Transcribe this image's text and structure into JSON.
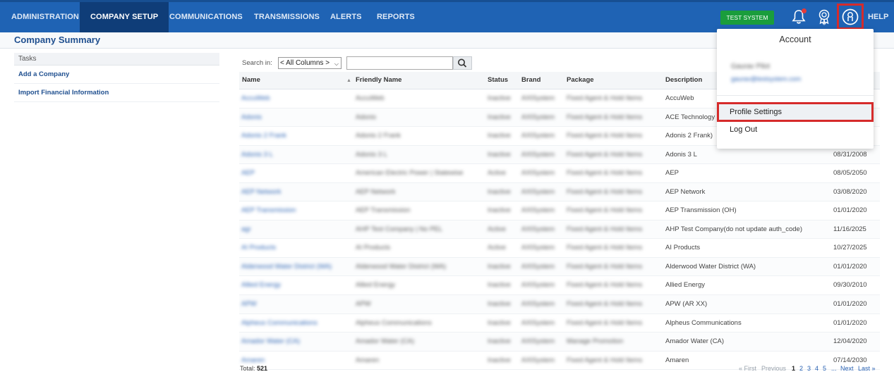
{
  "nav": {
    "items": [
      "ADMINISTRATION",
      "COMPANY SETUP",
      "COMMUNICATIONS",
      "TRANSMISSIONS",
      "ALERTS",
      "REPORTS"
    ],
    "active": "COMPANY SETUP",
    "test_badge": "TEST SYSTEM",
    "help": "HELP"
  },
  "page": {
    "title": "Company Summary"
  },
  "tasks": {
    "heading": "Tasks",
    "items": [
      "Add a Company",
      "Import Financial Information"
    ]
  },
  "search": {
    "label": "Search in:",
    "column_option": "< All Columns >",
    "placeholder": ""
  },
  "table": {
    "columns": [
      "Name",
      "Friendly Name",
      "Status",
      "Brand",
      "Package",
      "Description"
    ],
    "rows": [
      {
        "name": "AccuWeb",
        "friendly": "AccuWeb",
        "status": "Inactive",
        "brand": "AXISystem",
        "package": "Fixed Agent & Hold Items",
        "desc": "AccuWeb",
        "date": ""
      },
      {
        "name": "Adonis",
        "friendly": "Adonis",
        "status": "Inactive",
        "brand": "AXISystem",
        "package": "Fixed Agent & Hold Items",
        "desc": "ACE Technology",
        "date": ""
      },
      {
        "name": "Adonis 2 Frank",
        "friendly": "Adonis 2 Frank",
        "status": "Inactive",
        "brand": "AXISystem",
        "package": "Fixed Agent & Hold Items",
        "desc": "Adonis 2 Frank)",
        "date": ""
      },
      {
        "name": "Adonis 3 L",
        "friendly": "Adonis 3 L",
        "status": "Inactive",
        "brand": "AXISystem",
        "package": "Fixed Agent & Hold Items",
        "desc": "Adonis 3 L",
        "date": "08/31/2008"
      },
      {
        "name": "AEP",
        "friendly": "American Electric Power | Statewise",
        "status": "Active",
        "brand": "AXISystem",
        "package": "Fixed Agent & Hold Items",
        "desc": "AEP",
        "date": "08/05/2050"
      },
      {
        "name": "AEP Network",
        "friendly": "AEP Network",
        "status": "Inactive",
        "brand": "AXISystem",
        "package": "Fixed Agent & Hold Items",
        "desc": "AEP Network",
        "date": "03/08/2020"
      },
      {
        "name": "AEP Transmission",
        "friendly": "AEP Transmission",
        "status": "Inactive",
        "brand": "AXISystem",
        "package": "Fixed Agent & Hold Items",
        "desc": "AEP Transmission (OH)",
        "date": "01/01/2020"
      },
      {
        "name": "agr",
        "friendly": "AHP Test Company | No PEL",
        "status": "Active",
        "brand": "AXISystem",
        "package": "Fixed Agent & Hold Items",
        "desc": "AHP Test Company(do not update auth_code)",
        "date": "11/16/2025"
      },
      {
        "name": "AI Products",
        "friendly": "AI Products",
        "status": "Active",
        "brand": "AXISystem",
        "package": "Fixed Agent & Hold Items",
        "desc": "AI Products",
        "date": "10/27/2025"
      },
      {
        "name": "Alderwood Water District (WA)",
        "friendly": "Alderwood Water District (WA)",
        "status": "Inactive",
        "brand": "AXISystem",
        "package": "Fixed Agent & Hold Items",
        "desc": "Alderwood Water District (WA)",
        "date": "01/01/2020"
      },
      {
        "name": "Allied Energy",
        "friendly": "Allied Energy",
        "status": "Inactive",
        "brand": "AXISystem",
        "package": "Fixed Agent & Hold Items",
        "desc": "Allied Energy",
        "date": "09/30/2010"
      },
      {
        "name": "APW",
        "friendly": "APW",
        "status": "Inactive",
        "brand": "AXISystem",
        "package": "Fixed Agent & Hold Items",
        "desc": "APW (AR XX)",
        "date": "01/01/2020"
      },
      {
        "name": "Alpheus Communications",
        "friendly": "Alpheus Communications",
        "status": "Inactive",
        "brand": "AXISystem",
        "package": "Fixed Agent & Hold Items",
        "desc": "Alpheus Communications",
        "date": "01/01/2020"
      },
      {
        "name": "Amador Water (CA)",
        "friendly": "Amador Water (CA)",
        "status": "Inactive",
        "brand": "AXISystem",
        "package": "Manage Promotion",
        "desc": "Amador Water (CA)",
        "date": "12/04/2020"
      },
      {
        "name": "Amaren",
        "friendly": "Amaren",
        "status": "Inactive",
        "brand": "AXISystem",
        "package": "Fixed Agent & Hold Items",
        "desc": "Amaren",
        "date": "07/14/2030"
      }
    ]
  },
  "footer": {
    "total_label": "Total:",
    "total_value": "521",
    "first": "« First",
    "previous": "Previous",
    "pages": [
      "1",
      "2",
      "3",
      "4",
      "5"
    ],
    "current_page": "1",
    "ellipsis": "...",
    "next": "Next",
    "last": "Last »"
  },
  "account_menu": {
    "title": "Account",
    "user_name": "Gaurav Pilot",
    "user_email": "gaurav@testsystem.com",
    "items": [
      "Profile Settings",
      "Log Out"
    ]
  },
  "colors": {
    "nav_bg": "#1f63b4",
    "nav_active": "#0f3d78",
    "test_badge": "#1a9d3c",
    "highlight": "#d62b2b",
    "link": "#2a62b3"
  }
}
